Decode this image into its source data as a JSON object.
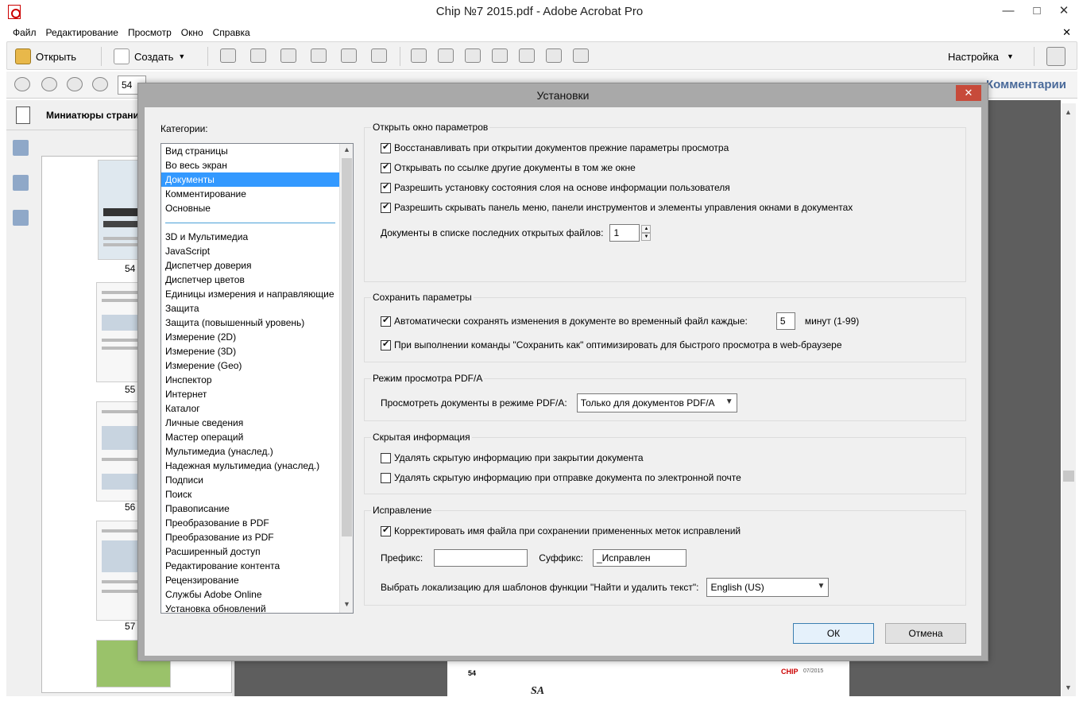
{
  "window": {
    "title": "Chip №7 2015.pdf - Adobe Acrobat Pro",
    "minimize": "—",
    "maximize": "□",
    "close": "✕"
  },
  "menubar": {
    "items": [
      "Файл",
      "Редактирование",
      "Просмотр",
      "Окно",
      "Справка"
    ],
    "close_doc": "✕"
  },
  "toolbar": {
    "open_label": "Открыть",
    "create_label": "Создать",
    "settings_label": "Настройка"
  },
  "toolbar2": {
    "page_number": "54",
    "comments_label": "Комментарии"
  },
  "left_panel": {
    "title": "Миниатюры страни",
    "thumbnails": [
      "54",
      "55",
      "56",
      "57"
    ]
  },
  "doc_page": {
    "page_number": "54",
    "brand": "CHIP",
    "issue": "07/2015"
  },
  "watermark": "SA",
  "dialog": {
    "title": "Установки",
    "close": "✕",
    "categories_label": "Категории:",
    "categories_top": [
      "Вид страницы",
      "Во весь экран",
      "Документы",
      "Комментирование",
      "Основные"
    ],
    "categories": [
      "3D и Мультимедиа",
      "JavaScript",
      "Диспетчер доверия",
      "Диспетчер цветов",
      "Единицы измерения и направляющие",
      "Защита",
      "Защита (повышенный уровень)",
      "Измерение (2D)",
      "Измерение (3D)",
      "Измерение (Geo)",
      "Инспектор",
      "Интернет",
      "Каталог",
      "Личные сведения",
      "Мастер операций",
      "Мультимедиа (унаслед.)",
      "Надежная мультимедиа (унаслед.)",
      "Подписи",
      "Поиск",
      "Правописание",
      "Преобразование в PDF",
      "Преобразование из PDF",
      "Расширенный доступ",
      "Редактирование контента",
      "Рецензирование",
      "Службы Adobe Online",
      "Установка обновлений"
    ],
    "selected_category": "Документы",
    "open_group": {
      "label": "Открыть окно параметров",
      "opt1": "Восстанавливать при открытии документов прежние параметры просмотра",
      "opt2": "Открывать по ссылке другие документы в том же окне",
      "opt3": "Разрешить установку состояния слоя на основе информации пользователя",
      "opt4": "Разрешить скрывать панель меню, панели инструментов и элементы управления окнами в документах",
      "recent_label": "Документы в списке последних открытых файлов:",
      "recent_value": "1"
    },
    "save_group": {
      "label": "Сохранить параметры",
      "autosave_label": "Автоматически сохранять изменения в документе во временный файл каждые:",
      "autosave_value": "5",
      "autosave_unit": "минут (1-99)",
      "optimize_label": "При выполнении команды \"Сохранить как\" оптимизировать для быстрого просмотра в web-браузере"
    },
    "pdfa_group": {
      "label": "Режим просмотра PDF/A",
      "view_label": "Просмотреть документы в режиме PDF/A:",
      "view_value": "Только для документов PDF/A"
    },
    "hidden_group": {
      "label": "Скрытая информация",
      "opt_close": "Удалять скрытую информацию при закрытии документа",
      "opt_email": "Удалять скрытую информацию при отправке документа по электронной почте"
    },
    "redaction_group": {
      "label": "Исправление",
      "correct_label": "Корректировать имя файла при сохранении примененных меток исправлений",
      "prefix_label": "Префикс:",
      "prefix_value": "",
      "suffix_label": "Суффикс:",
      "suffix_value": "_Исправлен",
      "locale_label": "Выбрать локализацию для шаблонов функции \"Найти и удалить текст\":",
      "locale_value": "English (US)"
    },
    "ok_label": "ОК",
    "cancel_label": "Отмена"
  }
}
